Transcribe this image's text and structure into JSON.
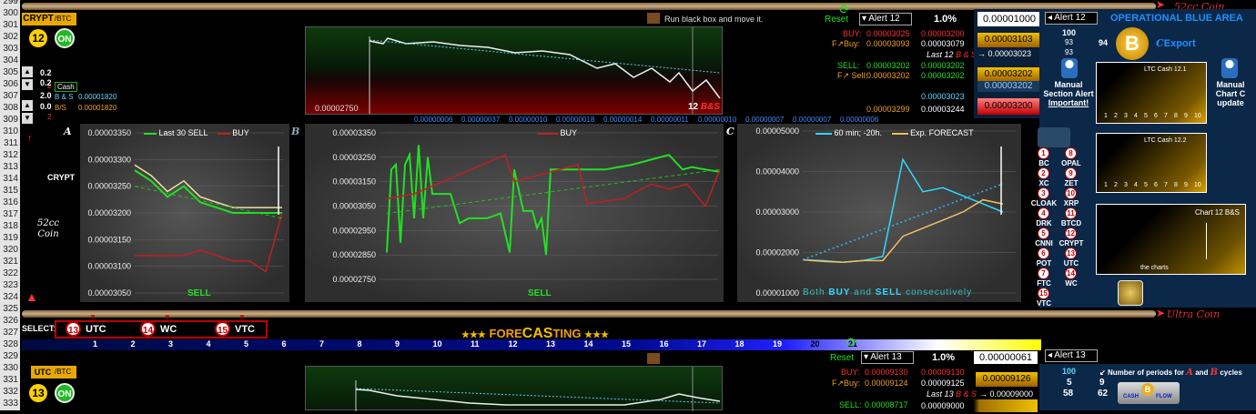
{
  "row_numbers": [
    "299",
    "300",
    "301",
    "302",
    "303",
    "304",
    "305",
    "306",
    "307",
    "308",
    "309",
    "310",
    "311",
    "312",
    "313",
    "314",
    "315",
    "316",
    "317",
    "318",
    "319",
    "320",
    "321",
    "322",
    "323",
    "324",
    "325",
    "326",
    "327",
    "328",
    "329",
    "330",
    "331",
    "332",
    "333"
  ],
  "top_banner": {
    "coin_label": "52cc Coin"
  },
  "bottom_banner": {
    "coin_label": "Ultra Coin"
  },
  "header_top": {
    "tag": "CRYPT",
    "pair": "/BTC",
    "num": "12",
    "status": "ON"
  },
  "header_bottom": {
    "tag": "UTC",
    "pair": "/BTC",
    "num": "13",
    "status": "ON"
  },
  "mini_legend": {
    "v1": "0.2",
    "v2": "0.2",
    "v3": "2.0",
    "v4": "0.0",
    "cash": "Cash",
    "bs": "B & S",
    "bs_val": "0.00001820",
    "bsr": "B/S",
    "bsr_val": "0.00001820",
    "num2a": "2",
    "num2b": "2"
  },
  "hint": "Run black box and move it.",
  "top_chart": {
    "ymin_label": "0.00002750",
    "tag_num": "12",
    "tag_bs": "B&S",
    "xticks": [
      "0.00000006",
      "0.00000037",
      "0.00000010",
      "0.00000018",
      "0.00000014",
      "0.00000011",
      "0.00000010",
      "0.00000007",
      "0.00000007",
      "0.00000006"
    ]
  },
  "chart_A": {
    "letter": "A",
    "left_label": "CRYPT",
    "coin_label": "52cc Coin",
    "legend": [
      "Last 30 SELL",
      "BUY"
    ],
    "bottom_label": "SELL",
    "chart_data": {
      "type": "line",
      "series": [
        {
          "name": "Last 30 SELL",
          "values": [
            3.28e-05,
            3.26e-05,
            3.23e-05,
            3.25e-05,
            3.22e-05,
            3.21e-05,
            3.2e-05,
            3.2e-05,
            3.2e-05,
            3.2e-05
          ]
        },
        {
          "name": "BUY",
          "values": [
            3.12e-05,
            3.12e-05,
            3.12e-05,
            3.12e-05,
            3.13e-05,
            3.12e-05,
            3.11e-05,
            3.11e-05,
            3.09e-05,
            3.2e-05
          ]
        }
      ],
      "ylim": [
        3.05e-05,
        3.35e-05
      ],
      "yticks": [
        "0.00003350",
        "0.00003300",
        "0.00003250",
        "0.00003200",
        "0.00003150",
        "0.00003100",
        "0.00003050"
      ]
    }
  },
  "chart_B": {
    "letter": "B",
    "legend": [
      "BUY"
    ],
    "bottom_label": "SELL",
    "chart_data": {
      "type": "line",
      "ylim": [
        2.75e-05,
        3.35e-05
      ],
      "yticks": [
        "0.00003350",
        "0.00003250",
        "0.00003150",
        "0.00003050",
        "0.00002950",
        "0.00002850",
        "0.00002750"
      ]
    }
  },
  "chart_C": {
    "letter": "C",
    "legend": [
      "60 min; -20h.",
      "Exp. FORECAST"
    ],
    "caption_pre": "Both",
    "caption_buy": "BUY",
    "caption_mid": "and",
    "caption_sell": "SELL",
    "caption_post": "consecutively",
    "chart_data": {
      "type": "line",
      "series": [
        {
          "name": "60 min; -20h.",
          "values": [
            1.82e-05,
            1.8e-05,
            1.76e-05,
            1.8e-05,
            1.9e-05,
            4.3e-05,
            3.5e-05,
            3.6e-05,
            3.4e-05,
            3.2e-05,
            3e-05
          ]
        },
        {
          "name": "Exp. FORECAST",
          "values": [
            1.82e-05,
            1.78e-05,
            1.76e-05,
            1.8e-05,
            1.8e-05,
            2.4e-05,
            2.6e-05,
            2.8e-05,
            3e-05,
            3.3e-05,
            3.2e-05
          ]
        }
      ],
      "ylim": [
        1e-05,
        5e-05
      ],
      "yticks": [
        "0.00005000",
        "0.00004000",
        "0.00003000",
        "0.00002000",
        "0.00001000"
      ]
    }
  },
  "alert_top": {
    "reset": "Reset",
    "alert_label": "Alert 12",
    "pct": "1.0%",
    "buy_label": "BUY:",
    "buy_v1": "0.00003025",
    "buy_v2": "0.00003200",
    "fbuy_label": "F↗Buy:",
    "fbuy_v1": "0.00003093",
    "fbuy_v2": "0.00003079",
    "last": "Last 12",
    "last_bs": "B & S",
    "arrow_val": "0.00003023",
    "sell_label": "SELL:",
    "sell_v1": "0.00003202",
    "sell_v2": "0.00003202",
    "fsell_label": "F↗ Sell:",
    "fsell_v1": "0.00003202",
    "fsell_v2": "0.00003202",
    "v_a": "0.00003023",
    "v_b": "0.00003244",
    "v_c": "0.00003299",
    "box1": "0.00001000",
    "box2": "0.00003103",
    "box3": "0.00003202",
    "box4": "0.00003202",
    "box5": "0.00003200",
    "box6": "0.00003023"
  },
  "alert_top_right": {
    "alert_label": "Alert 12",
    "n100": "100",
    "n93a": "93",
    "n93b": "93",
    "n94": "94"
  },
  "blue_area": {
    "title": "OPERATIONAL BLUE AREA",
    "export": "Export",
    "manual_section": "Manual",
    "section_alert": "Section Alert",
    "important": "Important!",
    "manual_chart": "Manual",
    "chart_c_update": "Chart C update",
    "ltc1": "LTC Cash 12.1",
    "ltc2": "LTC Cash 12.2",
    "chart12": "Chart 12 B&S",
    "the_charts": "the charts",
    "xticks": [
      "1",
      "2",
      "3",
      "4",
      "5",
      "6",
      "7",
      "8",
      "9",
      "10"
    ]
  },
  "coins": [
    {
      "n": "1",
      "name": "BC"
    },
    {
      "n": "8",
      "name": "OPAL"
    },
    {
      "n": "2",
      "name": "XC"
    },
    {
      "n": "9",
      "name": "ZET"
    },
    {
      "n": "3",
      "name": "CLOAK"
    },
    {
      "n": "10",
      "name": "XRP"
    },
    {
      "n": "4",
      "name": "DRK"
    },
    {
      "n": "11",
      "name": "BTCD"
    },
    {
      "n": "5",
      "name": "CNNI"
    },
    {
      "n": "12",
      "name": "CRYPT"
    },
    {
      "n": "6",
      "name": "POT"
    },
    {
      "n": "13",
      "name": "UTC"
    },
    {
      "n": "7",
      "name": "FTC"
    },
    {
      "n": "14",
      "name": "WC"
    },
    {
      "n": "15",
      "name": "VTC"
    }
  ],
  "select_bar": {
    "label": "SELECT:",
    "items": [
      {
        "n": "13",
        "name": "UTC"
      },
      {
        "n": "14",
        "name": "WC"
      },
      {
        "n": "15",
        "name": "VTC"
      }
    ]
  },
  "forecast": {
    "stars_l": "★★★",
    "title_a": "FORE",
    "title_b": "CAS",
    "title_c": "TING",
    "stars_r": "★★★"
  },
  "numbers_row": [
    "1",
    "2",
    "3",
    "4",
    "5",
    "6",
    "7",
    "8",
    "9",
    "10",
    "11",
    "12",
    "13",
    "14",
    "15",
    "16",
    "17",
    "18",
    "19",
    "20",
    "21"
  ],
  "alert_bottom": {
    "reset": "Reset",
    "alert_label": "Alert 13",
    "pct": "1.0%",
    "box1": "0.00000061",
    "buy_label": "BUY:",
    "buy_v1": "0.00009130",
    "buy_v2": "0.00009130",
    "fbuy_label": "F↗Buy:",
    "fbuy_v1": "0.00009124",
    "fbuy_v2": "0.00009125",
    "box2": "0.00009126",
    "last": "Last 13",
    "last_bs": "B & S",
    "arrow_val": "0.00009000",
    "sell_label": "SELL:",
    "sell_v1": "0.00008717",
    "sell_v2": "0.00009000"
  },
  "alert_bottom_right": {
    "alert_label": "Alert 13",
    "n100": "100",
    "n5": "5",
    "n58": "58",
    "n9": "9",
    "n62": "62",
    "periods_pre": "Number of periods for",
    "periods_a": "A",
    "periods_and": "and",
    "periods_b": "B",
    "periods_post": "cycles",
    "cash": "CASH",
    "flow": "FLOW"
  }
}
